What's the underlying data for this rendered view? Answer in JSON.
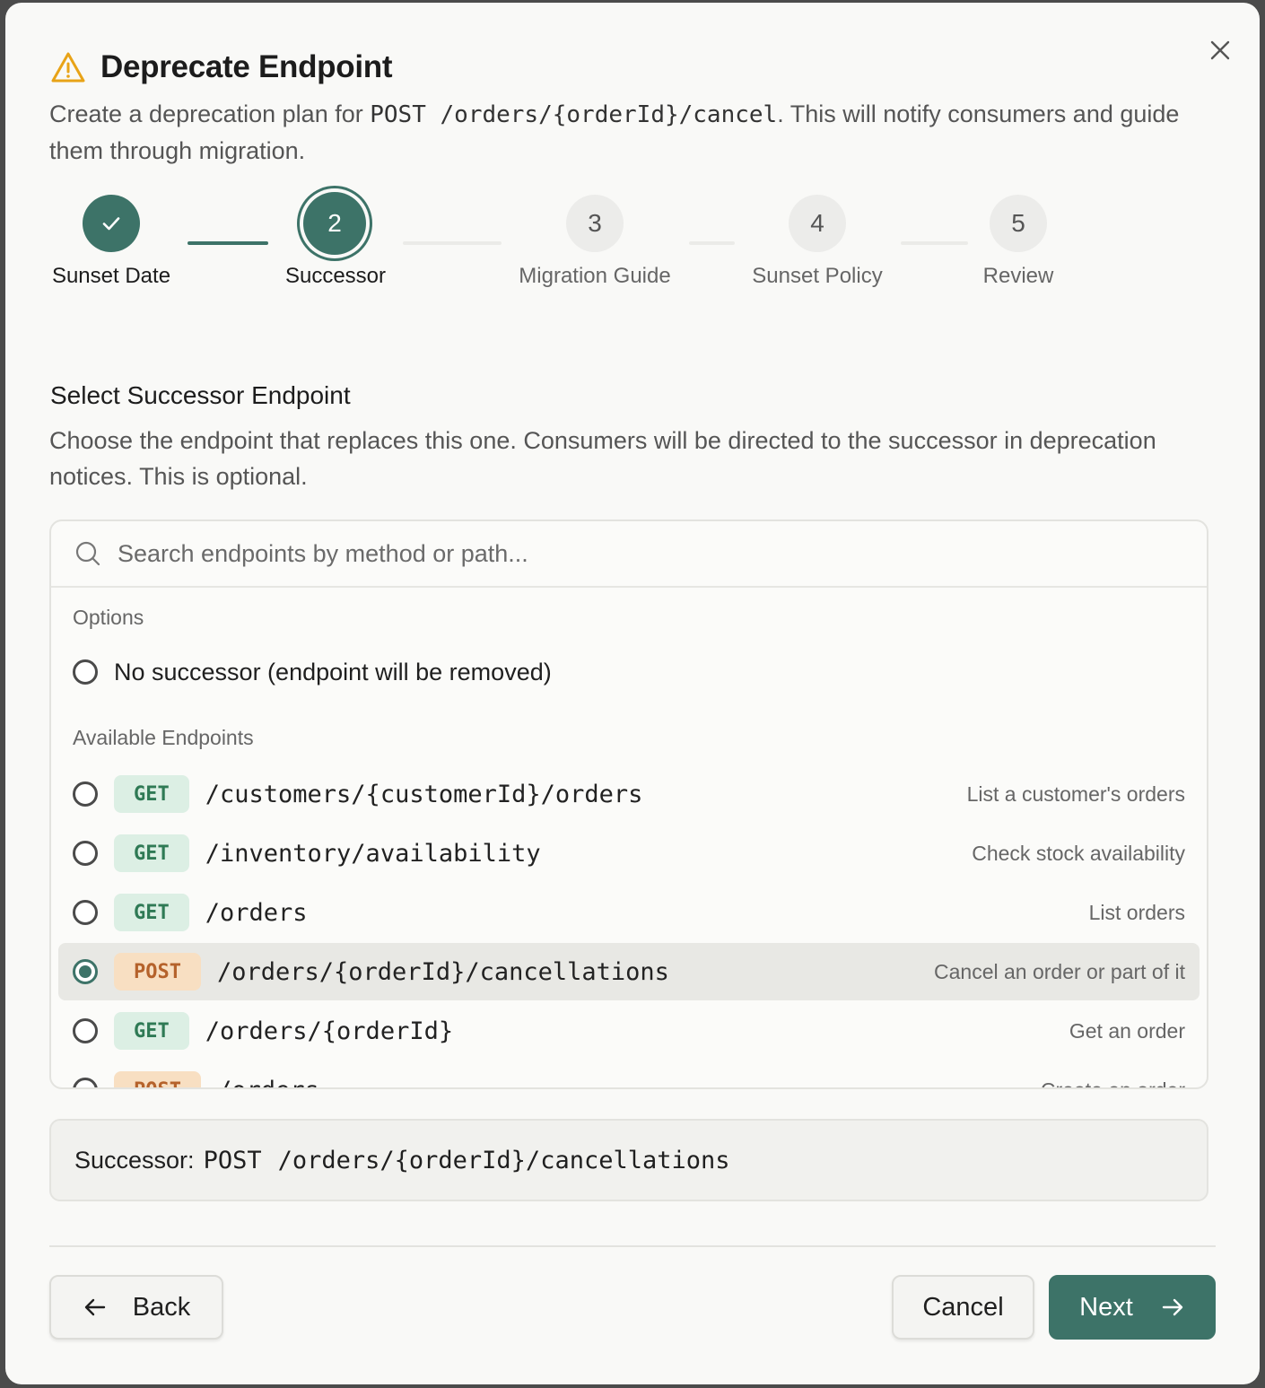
{
  "dialog": {
    "title": "Deprecate Endpoint",
    "subtitle_prefix": "Create a deprecation plan for ",
    "subtitle_method": "POST",
    "subtitle_path": "/orders/{orderId}/cancel",
    "subtitle_suffix": ". This will notify consumers and guide them through migration."
  },
  "steps": [
    {
      "number": "1",
      "label": "Sunset Date",
      "state": "done"
    },
    {
      "number": "2",
      "label": "Successor",
      "state": "active"
    },
    {
      "number": "3",
      "label": "Migration Guide",
      "state": "todo"
    },
    {
      "number": "4",
      "label": "Sunset Policy",
      "state": "todo"
    },
    {
      "number": "5",
      "label": "Review",
      "state": "todo"
    }
  ],
  "section": {
    "title": "Select Successor Endpoint",
    "description": "Choose the endpoint that replaces this one. Consumers will be directed to the successor in deprecation notices. This is optional."
  },
  "picker": {
    "search_placeholder": "Search endpoints by method or path...",
    "options_label": "Options",
    "no_successor_label": "No successor (endpoint will be removed)",
    "endpoints_label": "Available Endpoints",
    "endpoints": [
      {
        "method": "GET",
        "path": "/customers/{customerId}/orders",
        "description": "List a customer's orders",
        "selected": false
      },
      {
        "method": "GET",
        "path": "/inventory/availability",
        "description": "Check stock availability",
        "selected": false
      },
      {
        "method": "GET",
        "path": "/orders",
        "description": "List orders",
        "selected": false
      },
      {
        "method": "POST",
        "path": "/orders/{orderId}/cancellations",
        "description": "Cancel an order or part of it",
        "selected": true
      },
      {
        "method": "GET",
        "path": "/orders/{orderId}",
        "description": "Get an order",
        "selected": false
      },
      {
        "method": "POST",
        "path": "/orders",
        "description": "Create an order",
        "selected": false
      }
    ]
  },
  "summary": {
    "label": "Successor:",
    "method": "POST",
    "path": "/orders/{orderId}/cancellations"
  },
  "footer": {
    "back_label": "Back",
    "cancel_label": "Cancel",
    "next_label": "Next"
  },
  "colors": {
    "accent": "#3d7368",
    "get_badge_bg": "#dcefe4",
    "post_badge_bg": "#f8dfc2",
    "warning": "#e8a317"
  }
}
